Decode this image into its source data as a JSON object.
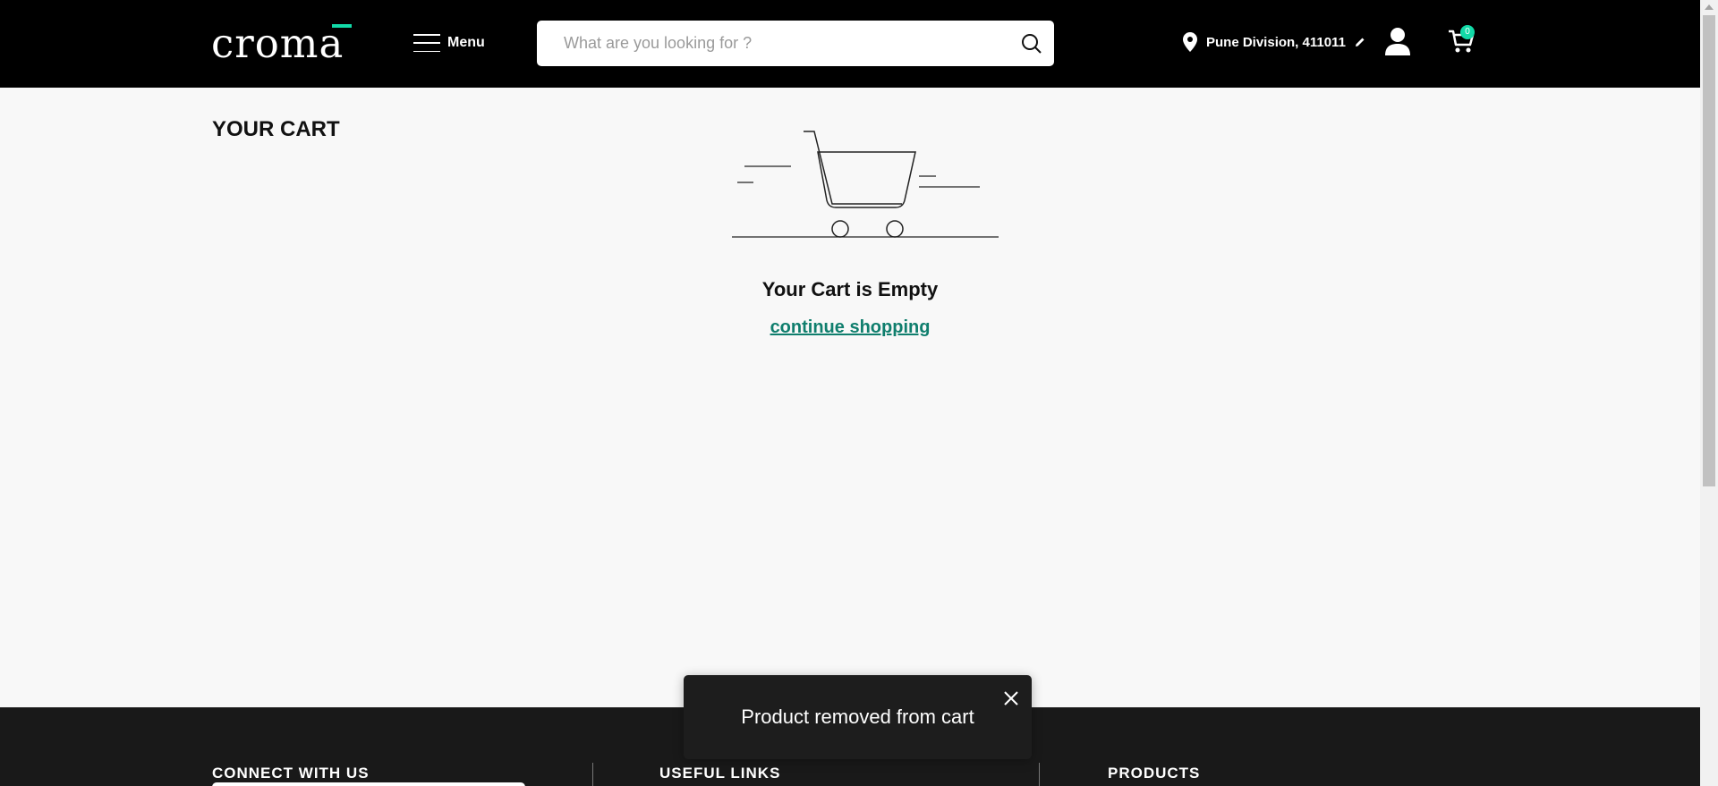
{
  "header": {
    "logo": "croma",
    "menu_label": "Menu",
    "search_placeholder": "What are you looking for ?",
    "location": "Pune Division, 411011",
    "cart_count": "0"
  },
  "main": {
    "title": "YOUR CART",
    "empty_message": "Your Cart is Empty",
    "continue_link": "continue shopping"
  },
  "footer": {
    "connect": "CONNECT WITH US",
    "useful_links": "USEFUL LINKS",
    "products": "PRODUCTS"
  },
  "toast": {
    "message": "Product removed from cart"
  },
  "colors": {
    "accent": "#12daa8",
    "link": "#0f7e6d",
    "header_bg": "#000000",
    "footer_bg": "#191919"
  }
}
